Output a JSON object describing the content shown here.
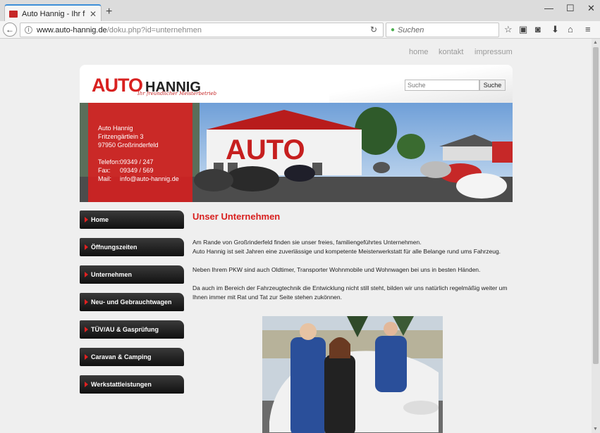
{
  "browser": {
    "tab_title": "Auto Hannig - Ihr freundli...",
    "url_host": "www.auto-hannig.de",
    "url_path": "/doku.php?id=unternehmen",
    "search_placeholder": "Suchen"
  },
  "topnav": {
    "home": "home",
    "kontakt": "kontakt",
    "impressum": "impressum"
  },
  "logo": {
    "auto": "AUTO",
    "hannig": "HANNIG",
    "tagline": "Ihr freundlicher Meisterbetrieb"
  },
  "site_search": {
    "placeholder": "Suche",
    "button": "Suche"
  },
  "banner": {
    "sign_text": "AUTO"
  },
  "contact": {
    "name": "Auto Hannig",
    "street": "Fritzengärtlein 3",
    "city": "97950 Großrinderfeld",
    "phone_label": "Telefon:",
    "phone": "09349 / 247",
    "fax_label": "Fax:",
    "fax": "09349 / 569",
    "mail_label": "Mail:",
    "mail": "info@auto-hannig.de"
  },
  "menu": [
    {
      "label": "Home"
    },
    {
      "label": "Öffnungszeiten"
    },
    {
      "label": "Unternehmen"
    },
    {
      "label": "Neu- und Gebrauchtwagen"
    },
    {
      "label": "TÜV/AU & Gasprüfung"
    },
    {
      "label": "Caravan & Camping"
    },
    {
      "label": "Werkstattleistungen"
    }
  ],
  "content": {
    "title": "Unser Unternehmen",
    "p1_line1": "Am Rande von Großrinderfeld finden sie unser freies, familiengeführtes Unternehmen.",
    "p1_line2": "Auto Hannig ist seit Jahren eine zuverlässige und kompetente Meisterwerkstatt für alle Belange rund ums Fahrzeug.",
    "p2": "Neben Ihrem PKW sind auch Oldtimer, Transporter Wohnmobile und Wohnwagen bei uns in besten Händen.",
    "p3": "Da auch im Bereich der Fahrzeugtechnik die Entwicklung nicht still steht, bilden wir uns natürlich regelmäßig weiter um Ihnen immer mit Rat und Tat zur Seite stehen zukönnen."
  }
}
